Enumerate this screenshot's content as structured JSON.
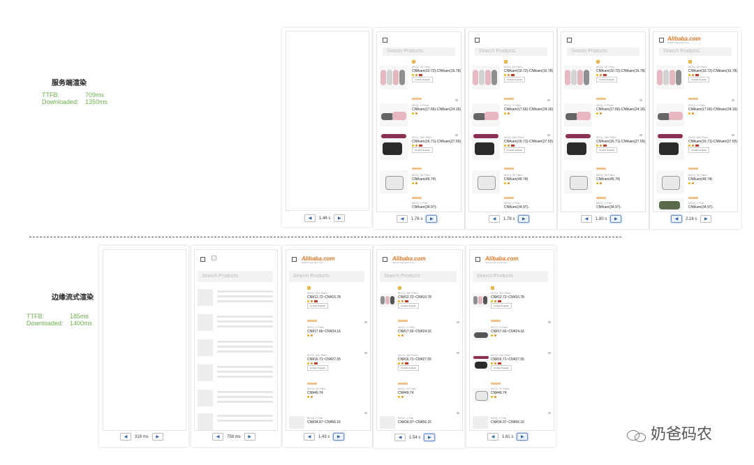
{
  "sections": [
    {
      "title": "服务端渲染",
      "metrics": [
        {
          "label": "TTFB:",
          "value": "709ms"
        },
        {
          "label": "Downloaded:",
          "value": "1350ms"
        }
      ],
      "frames": [
        {
          "time": "1.48 s"
        },
        {
          "time": "1.76 s"
        },
        {
          "time": "1.78 s"
        },
        {
          "time": "1.80 s"
        },
        {
          "time": "2.16 s"
        }
      ]
    },
    {
      "title": "边缘流式渲染",
      "metrics": [
        {
          "label": "TTFB:",
          "value": "185ms"
        },
        {
          "label": "Downloaded:",
          "value": "1400ms"
        }
      ],
      "frames": [
        {
          "time": "319 ms"
        },
        {
          "time": "759 ms"
        },
        {
          "time": "1.43 s"
        },
        {
          "time": "1.54 s"
        },
        {
          "time": "1.61 s"
        }
      ]
    }
  ],
  "app": {
    "logo_text": "Alibaba.com",
    "logo_sub": "Global trade starts here",
    "search_placeholder": "Search Products",
    "contact_label": "Contact Supplier"
  },
  "products_top": [
    {
      "moq": "MOQ: 50 Pairs",
      "price": "CN¥uen(10.72)-CN¥uen(16.78)",
      "unit": "/Pair"
    },
    {
      "moq": "MOQ: 2 Pairs",
      "price": "CN¥uen(17.66)-CN¥uen(24.16)",
      "unit": "/Pair"
    },
    {
      "moq": "MOQ: 500 Pairs",
      "price": "CN¥uen(16.71)-CN¥uen(27.55)",
      "unit": "/Piece"
    },
    {
      "moq": "MOQ: 30 Pairs",
      "price": "CN¥uen(49.74)",
      "unit": "/Pair"
    },
    {
      "moq": "MOQ: 1 Pair",
      "price": "CN¥uen(34.97)-",
      "unit": ""
    }
  ],
  "products_bottom": [
    {
      "moq": "MOQ: 300 Pairs",
      "price": "CN¥12.72~CN¥16.78",
      "unit": "/Pair"
    },
    {
      "moq": "MOQ: 2 Pairs",
      "price": "CN¥17.66~CN¥24.16",
      "unit": "/Pair"
    },
    {
      "moq": "MOQ: 300 Pairs",
      "price": "CN¥16.71~CN¥27.55",
      "unit": "/Piece"
    },
    {
      "moq": "MOQ: 20 Pairs",
      "price": "CN¥49.74",
      "unit": "/Pair"
    },
    {
      "moq": "MOQ: 1 Pair",
      "price": "CN¥34.97~CN¥56.16",
      "unit": "/Pair"
    }
  ],
  "watermark": "奶爸码农",
  "colors": {
    "metrics": "#6ab04c",
    "brand": "#e8741e",
    "nav_arrow": "#2b5fa8"
  }
}
